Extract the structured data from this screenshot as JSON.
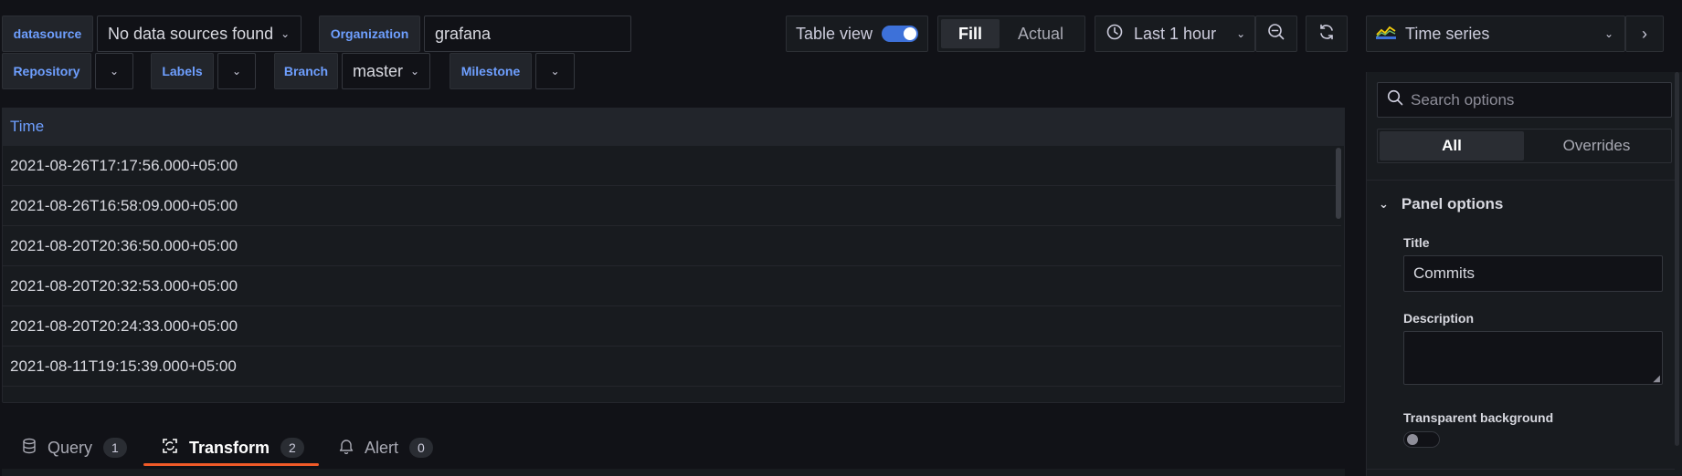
{
  "variables": {
    "datasource_label": "datasource",
    "datasource_value": "No data sources found",
    "organization_label": "Organization",
    "organization_value": "grafana",
    "repository_label": "Repository",
    "labels_label": "Labels",
    "branch_label": "Branch",
    "branch_value": "master",
    "milestone_label": "Milestone"
  },
  "toolbar": {
    "table_view_label": "Table view",
    "table_view_on": true,
    "fill_label": "Fill",
    "actual_label": "Actual",
    "time_range_label": "Last 1 hour"
  },
  "table": {
    "column_header": "Time",
    "rows": [
      "2021-08-26T17:17:56.000+05:00",
      "2021-08-26T16:58:09.000+05:00",
      "2021-08-20T20:36:50.000+05:00",
      "2021-08-20T20:32:53.000+05:00",
      "2021-08-20T20:24:33.000+05:00",
      "2021-08-11T19:15:39.000+05:00"
    ]
  },
  "bottom_tabs": [
    {
      "label": "Query",
      "count": "1",
      "icon": "database-icon"
    },
    {
      "label": "Transform",
      "count": "2",
      "icon": "transform-icon"
    },
    {
      "label": "Alert",
      "count": "0",
      "icon": "bell-icon"
    }
  ],
  "options": {
    "visualization": "Time series",
    "search_placeholder": "Search options",
    "tab_all": "All",
    "tab_overrides": "Overrides",
    "section_title": "Panel options",
    "title_label": "Title",
    "title_value": "Commits",
    "description_label": "Description",
    "description_value": "",
    "transparent_label": "Transparent background"
  },
  "colors": {
    "accent_blue": "#3d71d9",
    "label_blue": "#6e9fff",
    "active_tab_underline": "#f05a28"
  }
}
